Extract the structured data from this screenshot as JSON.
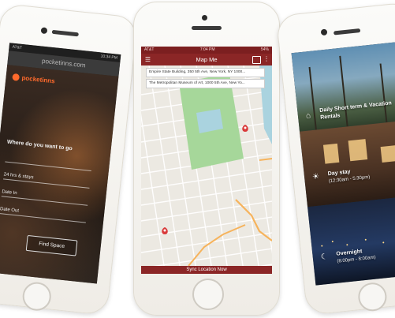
{
  "left_phone": {
    "status_carrier": "AT&T",
    "status_time": "10:34 PM",
    "url": "pocketinns.com",
    "brand": "pocketinns",
    "question": "Where do you want to go",
    "fields": [
      "24 hrs & stays",
      "Date In",
      "Date Out"
    ],
    "find_button": "Find Space"
  },
  "center_phone": {
    "status_carrier": "AT&T",
    "status_time": "7:04 PM",
    "status_battery": "54%",
    "title": "Map Me",
    "origin_input": "Empire State Building, 350 5th Ave, New York, NY 1000...",
    "destination_input": "The Metropolitan Museum of Art, 1000 5th Ave, New Yo...",
    "footer_button": "Sync Location Now",
    "map_colors": {
      "park": "#a6d79a",
      "road": "#ffffff",
      "highway": "#f6b35c",
      "water": "#aad3df",
      "land": "#ece9e2",
      "marker": "#d93a3a"
    }
  },
  "right_phone": {
    "categories": [
      {
        "title": "Daily Short term & Vacation Rentals",
        "subtitle": ""
      },
      {
        "title": "Day stay",
        "subtitle": "(12:30am - 5:30pm)"
      },
      {
        "title": "Overnight",
        "subtitle": "(8:00pm - 8:00am)"
      }
    ]
  }
}
